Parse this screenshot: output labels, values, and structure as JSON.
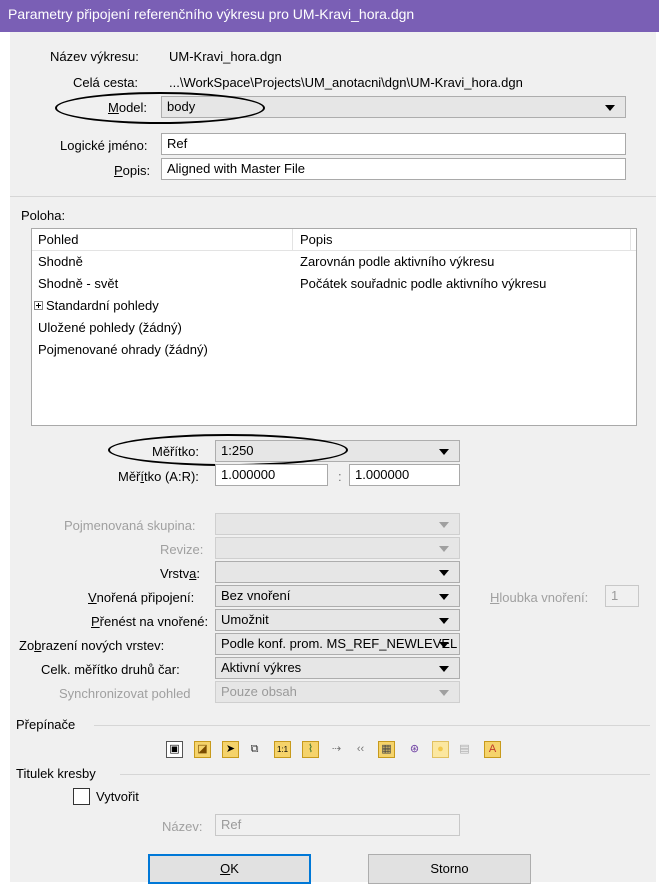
{
  "window": {
    "title": "Parametry připojení referenčního výkresu pro UM-Kravi_hora.dgn"
  },
  "info": {
    "nazev_label": "Název výkresu:",
    "nazev_value": "UM-Kravi_hora.dgn",
    "cesta_label": "Celá cesta:",
    "cesta_value": "...\\WorkSpace\\Projects\\UM_anotacni\\dgn\\UM-Kravi_hora.dgn",
    "model_label_pre": "",
    "model_label_u": "M",
    "model_label_post": "odel:",
    "model_value": "body",
    "logicke_label_pre": "Lo",
    "logicke_label_u": "g",
    "logicke_label_post": "ické jméno:",
    "logicke_value": "Ref",
    "popis_label_u": "P",
    "popis_label_post": "opis:",
    "popis_value": "Aligned with Master File"
  },
  "poloha": {
    "label": "Poloha:",
    "col_pohled": "Pohled",
    "col_popis": "Popis",
    "rows": [
      {
        "pohled": "Shodně",
        "popis": "Zarovnán podle aktivního výkresu",
        "expander": false
      },
      {
        "pohled": "Shodně - svět",
        "popis": "Počátek souřadnic podle aktivního výkresu",
        "expander": false
      },
      {
        "pohled": "Standardní pohledy",
        "popis": "",
        "expander": true
      },
      {
        "pohled": "Uložené pohledy (žádný)",
        "popis": "",
        "expander": false
      },
      {
        "pohled": "Pojmenované ohrady (žádný)",
        "popis": "",
        "expander": false
      }
    ]
  },
  "scale": {
    "meritko_label": "Měřítko:",
    "meritko_value": "1:250",
    "ar_label_pre": "Měř",
    "ar_label_u": "í",
    "ar_label_post": "tko (A:R):",
    "ar_a": "1.000000",
    "ar_sep": ":",
    "ar_r": "1.000000"
  },
  "options": {
    "pojmenovana_label": "Pojmenovaná skupina:",
    "revize_label": "Revize:",
    "vrstva_label_pre": "Vrstv",
    "vrstva_label_u": "a",
    "vrstva_label_post": ":",
    "vnorena_label_u": "V",
    "vnorena_label_post": "nořená připojení:",
    "vnorena_value": "Bez vnoření",
    "hloubka_label_u": "H",
    "hloubka_label_post": "loubka vnoření:",
    "hloubka_value": "1",
    "prenest_label_u": "P",
    "prenest_label_post": "řenést na vnořené:",
    "prenest_value": "Umožnit",
    "zobrazeni_label_pre": "Zo",
    "zobrazeni_label_u": "b",
    "zobrazeni_label_post": "razení nových vrstev:",
    "zobrazeni_value": "Podle konf. prom. MS_REF_NEWLEVEL",
    "celk_label": "Celk. měřítko druhů čar:",
    "celk_value": "Aktivní výkres",
    "synchro_label": "Synchronizovat pohled",
    "synchro_value": "Pouze obsah"
  },
  "prepinace": {
    "label": "Přepínače",
    "icons": [
      "display-icon",
      "snap-icon",
      "locate-icon",
      "treat-as-element-icon",
      "true-scale-icon",
      "scale-line-styles-icon",
      "ignore-attachment-icon",
      "display-raster-icon",
      "level-table-icon",
      "use-lighting-icon",
      "light-bulb-icon",
      "clip-icon",
      "annotation-scale-icon"
    ],
    "icon_glyphs": [
      "▣",
      "◪",
      "➤",
      "⧉",
      "1:1",
      "⌇",
      "⇢",
      "‹‹",
      "▦",
      "⊛",
      "●",
      "▤",
      "A"
    ]
  },
  "titulek": {
    "label": "Titulek kresby",
    "vytvorit_label": "Vytvořit",
    "nazev_label": "Název:",
    "nazev_value": "Ref"
  },
  "buttons": {
    "ok_u": "O",
    "ok_post": "K",
    "storno": "Storno"
  },
  "colors": {
    "titlebar": "#7a5fb5",
    "dialog_bg": "#f0f0f0",
    "default_button_border": "#0078d7"
  }
}
